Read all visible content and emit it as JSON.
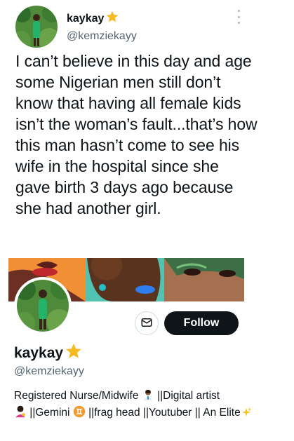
{
  "tweet": {
    "author_name": "kaykay",
    "author_handle": "@kemziekayy",
    "text": "I can’t believe in this day and age some Nigerian men still don’t know that having all female kids isn’t the woman’s fault...that’s how this man hasn’t come to see his wife in the hospital since she gave birth 3 days ago because she had another girl.",
    "name_emoji": "star-icon",
    "more_icon": "more-vertical-icon"
  },
  "profile": {
    "name": "kaykay",
    "handle": "@kemziekayy",
    "follow_label": "Follow",
    "message_icon": "mail-icon",
    "bio_parts": {
      "p1": "Registered Nurse/Midwife ",
      "p2": " ||Digital artist",
      "p3": " ||Gemini ",
      "p4": " ||frag head ||Youtuber || An Elite"
    },
    "bio_emojis": [
      "health-worker-icon",
      "artist-icon",
      "gemini-icon",
      "sparkles-icon"
    ]
  },
  "colors": {
    "text": "#0f1419",
    "secondary": "#536471",
    "follow_bg": "#0f1419",
    "star": "#f5b921"
  }
}
